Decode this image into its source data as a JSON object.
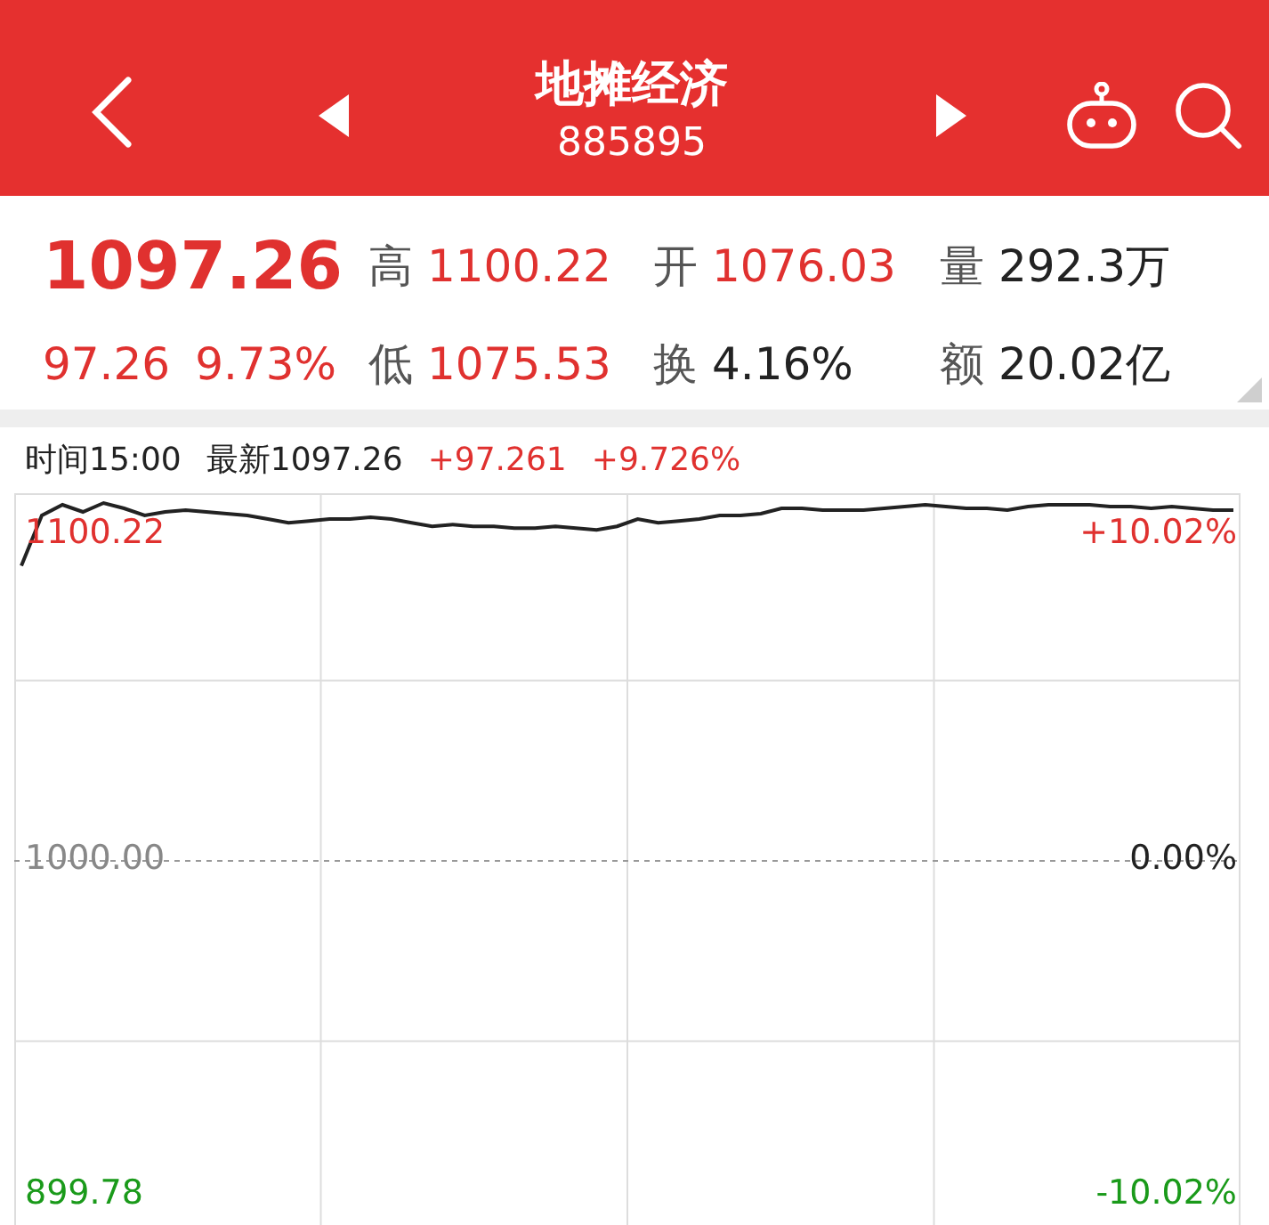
{
  "header": {
    "title": "地摊经济",
    "code": "885895"
  },
  "quote": {
    "price": "1097.26",
    "change": "97.26",
    "change_pct": "9.73%",
    "stats": [
      {
        "label": "高",
        "value": "1100.22",
        "kind": "up"
      },
      {
        "label": "开",
        "value": "1076.03",
        "kind": "up"
      },
      {
        "label": "量",
        "value": "292.3万",
        "kind": "neutral"
      },
      {
        "label": "低",
        "value": "1075.53",
        "kind": "up"
      },
      {
        "label": "换",
        "value": "4.16%",
        "kind": "neutral"
      },
      {
        "label": "额",
        "value": "20.02亿",
        "kind": "neutral"
      }
    ]
  },
  "info_line": {
    "time": "时间15:00",
    "latest": "最新1097.26",
    "change": "+97.261",
    "change_pct": "+9.726%"
  },
  "chart": {
    "left_labels": [
      {
        "text": "1100.22",
        "kind": "up"
      },
      {
        "text": "1000.00",
        "kind": "flat"
      },
      {
        "text": "899.78",
        "kind": "down"
      }
    ],
    "right_labels": [
      {
        "text": "+10.02%",
        "kind": "up"
      },
      {
        "text": "0.00%",
        "kind": "flat"
      },
      {
        "text": "-10.02%",
        "kind": "down"
      }
    ]
  }
}
